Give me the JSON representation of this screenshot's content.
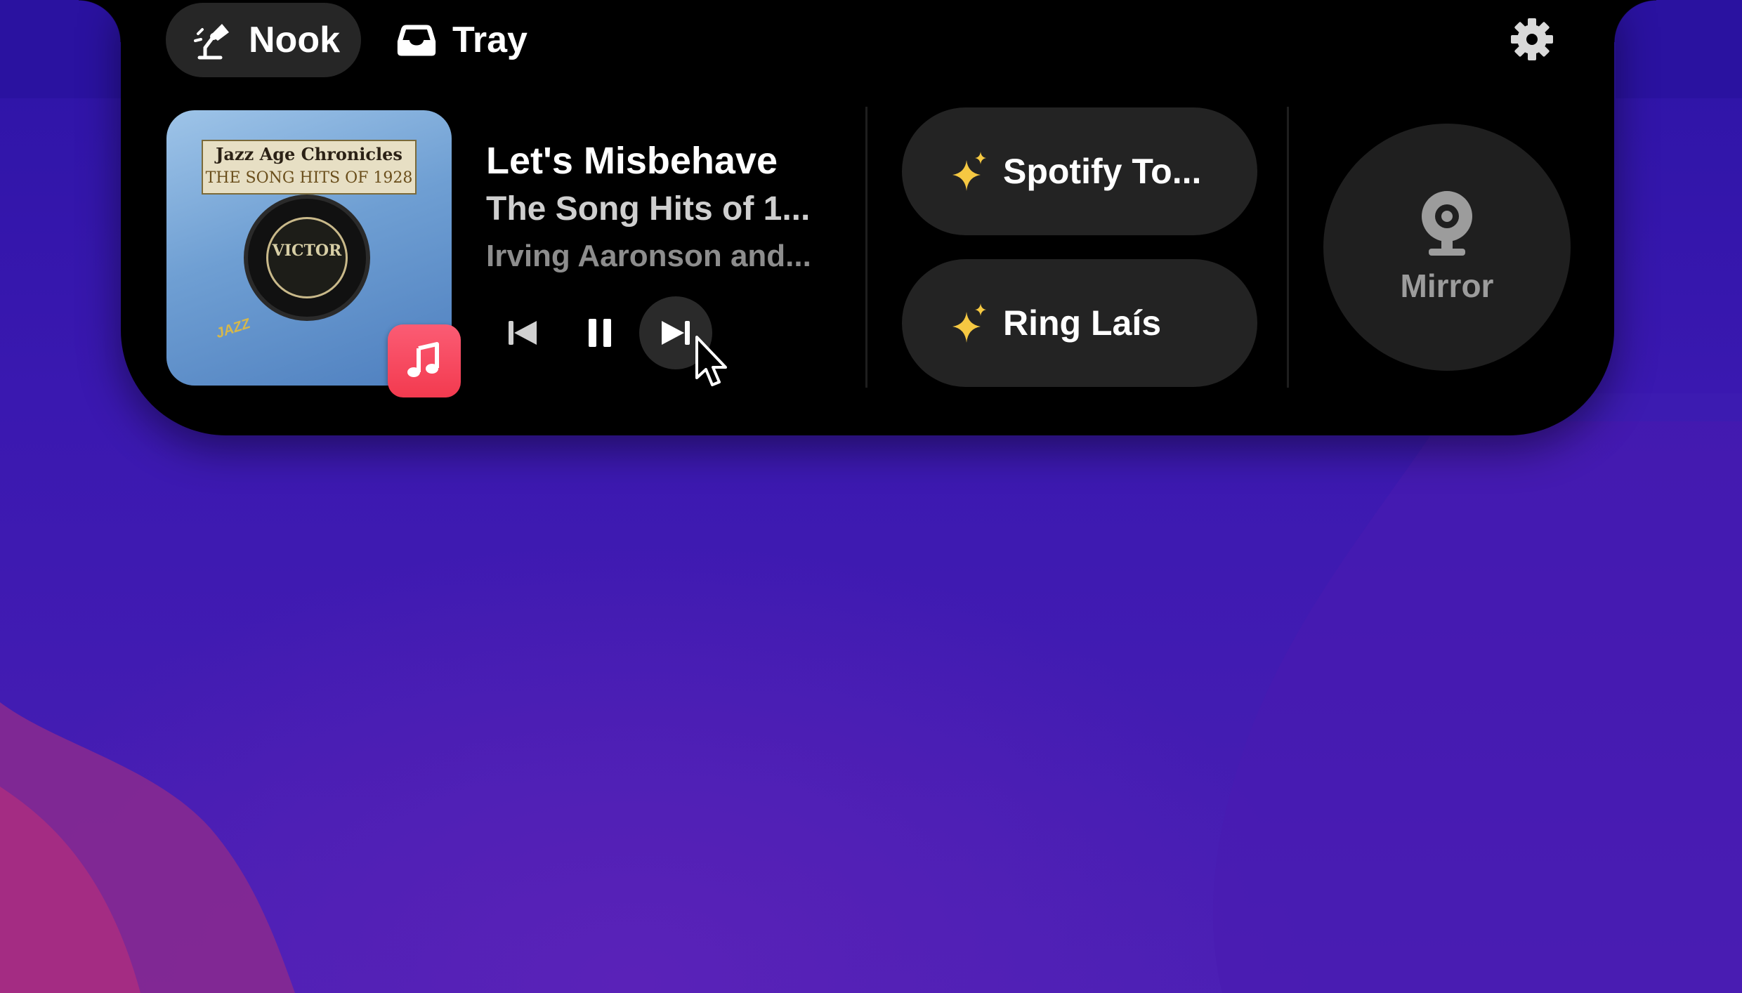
{
  "tabs": [
    {
      "label": "Nook",
      "icon": "desk-lamp-icon",
      "active": true
    },
    {
      "label": "Tray",
      "icon": "tray-icon",
      "active": false
    }
  ],
  "settings": {
    "icon": "gear-icon"
  },
  "now_playing": {
    "artwork": {
      "banner_line1": "Jazz Age Chronicles",
      "banner_line2": "THE SONG HITS OF 1928",
      "record_label": "VICTOR",
      "tag": "JAZZ"
    },
    "source_badge": "music-note-icon",
    "title": "Let's Misbehave",
    "album": "The Song Hits of 1...",
    "artist": "Irving Aaronson and...",
    "controls": [
      "previous-track",
      "pause",
      "next-track"
    ]
  },
  "shortcuts": [
    {
      "label": "Spotify To...",
      "icon": "sparkles-icon"
    },
    {
      "label": "Ring Laís",
      "icon": "sparkles-icon"
    }
  ],
  "mirror": {
    "label": "Mirror",
    "icon": "webcam-icon"
  },
  "colors": {
    "notch": "#000000",
    "pill": "#232323",
    "sparkle": "#f5c842",
    "music_badge": "#f33a4f",
    "wallpaper": "#3a18b0"
  }
}
